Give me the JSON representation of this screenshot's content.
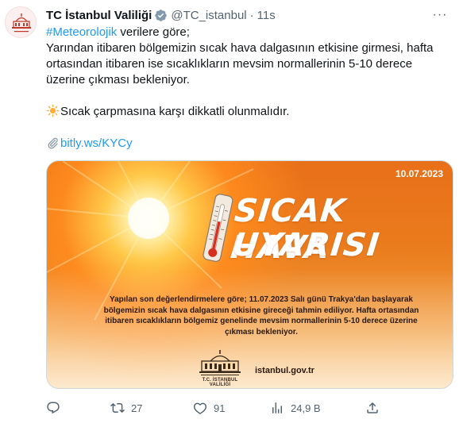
{
  "account": {
    "display_name": "TC İstanbul Valiliği",
    "handle": "@TC_istanbul",
    "separator": "·",
    "time": "11s",
    "more": "···"
  },
  "tweet": {
    "hashtag": "#Meteorolojik",
    "line1_rest": " verilere göre;",
    "paragraph": "Yarından itibaren bölgemizin sıcak hava dalgasının etkisine girmesi, hafta ortasından itibaren ise sıcaklıkların mevsim normallerinin 5-10 derece üzerine çıkması bekleniyor.",
    "warning": "Sıcak çarpmasına karşı dikkatli olunmalıdır.",
    "link": "bitly.ws/KYCy"
  },
  "media": {
    "date": "10.07.2023",
    "headline_line1": "SICAK HAVA",
    "headline_line2": "UYARISI",
    "announcement": "Yapılan son değerlendirmelere göre; 11.07.2023 Salı günü Trakya'dan başlayarak bölgemizin sıcak hava dalgasının etkisine gireceği tahmin ediliyor. Hafta ortasından itibaren sıcaklıkların bölgemiz genelinde mevsim normallerinin 5-10 derece üzerine çıkması bekleniyor.",
    "logo_caption": "T.C. İSTANBUL VALİLİĞİ",
    "site": "istanbul.gov.tr"
  },
  "actions": {
    "reply_count": "",
    "retweet_count": "27",
    "like_count": "91",
    "views_count": "24,9 B"
  },
  "icons": {
    "verified": "verified-badge-icon",
    "sun_emoji": "sun-emoji-icon",
    "paperclip_emoji": "paperclip-emoji-icon",
    "reply": "reply-icon",
    "retweet": "retweet-icon",
    "like": "heart-icon",
    "views": "views-icon",
    "share": "share-icon"
  },
  "colors": {
    "link": "#1d9bf0",
    "muted": "#536471",
    "verified": "#829aab"
  }
}
